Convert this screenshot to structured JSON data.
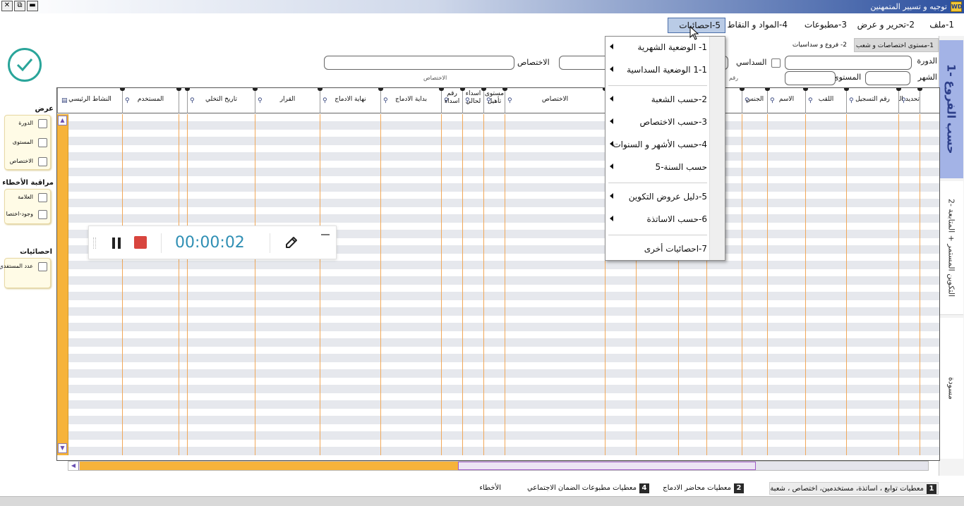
{
  "window": {
    "title": "توجيه و تسيير المتمهنين",
    "app_icon": "WD",
    "close": "✕",
    "restore": "⧉",
    "minimize": "▬"
  },
  "menu": [
    {
      "label": "1-ملف"
    },
    {
      "label": "2-تحرير و عرض"
    },
    {
      "label": "3-مطبوعات"
    },
    {
      "label": "4-المواد و النقاط"
    },
    {
      "label": "5-احصائيات",
      "active": true
    }
  ],
  "dropdown": {
    "items": [
      {
        "label": "1- الوضعية الشهرية"
      },
      {
        "label": "1-1 الوضعية السداسية"
      },
      {
        "label": "2-حسب الشعبة"
      },
      {
        "label": "3-حسب الاختصاص"
      },
      {
        "label": "4-حسب الأشهر و السنوات"
      },
      {
        "label": "حسب السنة-5"
      },
      {
        "label": "5-دليل عروض التكوين"
      },
      {
        "label": "6-حسب الاساتذة"
      },
      {
        "label": "7-احصائيات أخرى"
      }
    ]
  },
  "right_tabs": {
    "tab1": "1- حسب الفروع",
    "tab2": "2- التكوين المستمر + المتابعة",
    "tab3": "مسودة"
  },
  "sub_tabs": {
    "a": "1-مستوى اختصاصات و شعب",
    "b": "2- فروع و سداسيات"
  },
  "filters": {
    "session_label": "الدورة",
    "level_label": "المستوى",
    "month_label": "الشهر",
    "semester_label": "السداسي",
    "specialty_label": "الاختصاص",
    "specialty_hint": "الاختصاص",
    "number_hint": "رقم"
  },
  "left_panel": {
    "display_title": "عرض",
    "display_options": [
      "الدورة",
      "المستوى",
      "الاختصاص"
    ],
    "errors_title": "مراقبة الأخطاء",
    "errors_options": [
      "العلامة",
      "وجود-اختصا"
    ],
    "stats_title": "احصائيات",
    "stats_options": [
      "عدد المستفدي"
    ]
  },
  "grid": {
    "columns": [
      {
        "label": "تحديد الرقم"
      },
      {
        "label": ""
      },
      {
        "label": "رقم التسجيل"
      },
      {
        "label": "اللقب"
      },
      {
        "label": "الاسم"
      },
      {
        "label": "الجنس"
      },
      {
        "label": ""
      },
      {
        "label": ""
      },
      {
        "label": ""
      },
      {
        "label": ""
      },
      {
        "label": "الاختصاص"
      },
      {
        "label": "مستوى تأهيل"
      },
      {
        "label": "اسداء لحالي"
      },
      {
        "label": "رقم اسداء"
      },
      {
        "label": "بداية الادماج"
      },
      {
        "label": "نهاية الادماج"
      },
      {
        "label": "القرار"
      },
      {
        "label": "تاريخ التخلي"
      },
      {
        "label": ""
      },
      {
        "label": "المستخدم"
      },
      {
        "label": "النشاط الرئيسي"
      }
    ]
  },
  "recorder": {
    "time": "00:00:02"
  },
  "statusbar": {
    "items": [
      {
        "num": "1",
        "label": "معطيات توابع ، اساتذة، مستخدمين، اختصاص ، شعبة",
        "active": true
      },
      {
        "num": "2",
        "label": "معطيات محاضر الادماج"
      },
      {
        "num": "4",
        "label": "معطيات مطبوعات الضمان الاجتماعي"
      },
      {
        "num": "",
        "label": "الأخطاء"
      }
    ]
  },
  "colors": {
    "accent_blue": "#a3b3e6",
    "scroll_orange": "#f6b33a",
    "check_teal": "#2aa59a",
    "recorder_time": "#2f8fb4",
    "stop_red": "#d8453e"
  }
}
